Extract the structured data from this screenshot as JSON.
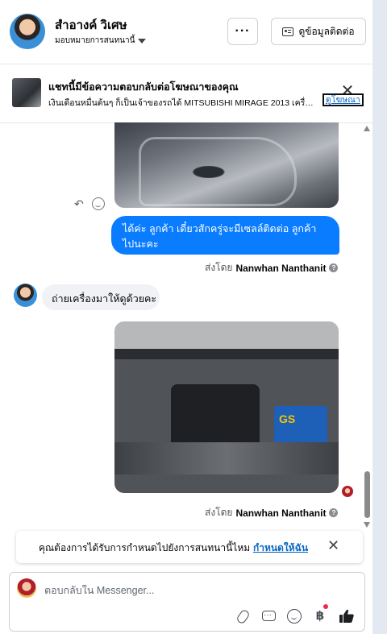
{
  "header": {
    "contact_name": "สำอางค์ วิเศษ",
    "assign_label": "มอบหมายการสนทนานี้",
    "more_label": "···",
    "contact_info_label": "ดูข้อมูลติดต่อ"
  },
  "ad_banner": {
    "title": "แชทนี้มีข้อความตอบกลับต่อโฆษณาของคุณ",
    "text": "เงินเดือนหมื่นต้นๆ ก็เป็นเจ้าของรถได้ MITSUBISHI MIRAGE 2013 เครื่อง...",
    "link_label": "ดูโฆษณา",
    "close_label": "✕"
  },
  "messages": {
    "outgoing_text": "ได้ค่ะ ลูกค้า เดี๋ยวสักครู่จะมีเซลล์ติดต่อ ลูกค้า ไปนะคะ",
    "sent_by_prefix": "ส่งโดย",
    "sent_by_name": "Nanwhan Nanthanit",
    "incoming_text": "ถ่ายเครื่องมาให้ดูด้วยคะ",
    "battery_brand": "GS",
    "reply_icon": "↶"
  },
  "notification": {
    "text": "คุณต้องการได้รับการกำหนดไปยังการสนทนานี้ไหม",
    "link_label": "กำหนดให้ฉัน",
    "close_label": "✕"
  },
  "composer": {
    "placeholder": "ตอบกลับใน Messenger...",
    "baht_symbol": "฿"
  },
  "icons": [
    "dots-icon",
    "id-card-icon",
    "chevron-down-icon",
    "reply-icon",
    "smile-icon",
    "help-icon",
    "paperclip-icon",
    "quick-reply-icon",
    "emoji-icon",
    "baht-icon",
    "thumbs-up-icon"
  ],
  "colors": {
    "accent": "#0a7cff",
    "link": "#0a66c2",
    "notification_dot": "#f02849"
  }
}
